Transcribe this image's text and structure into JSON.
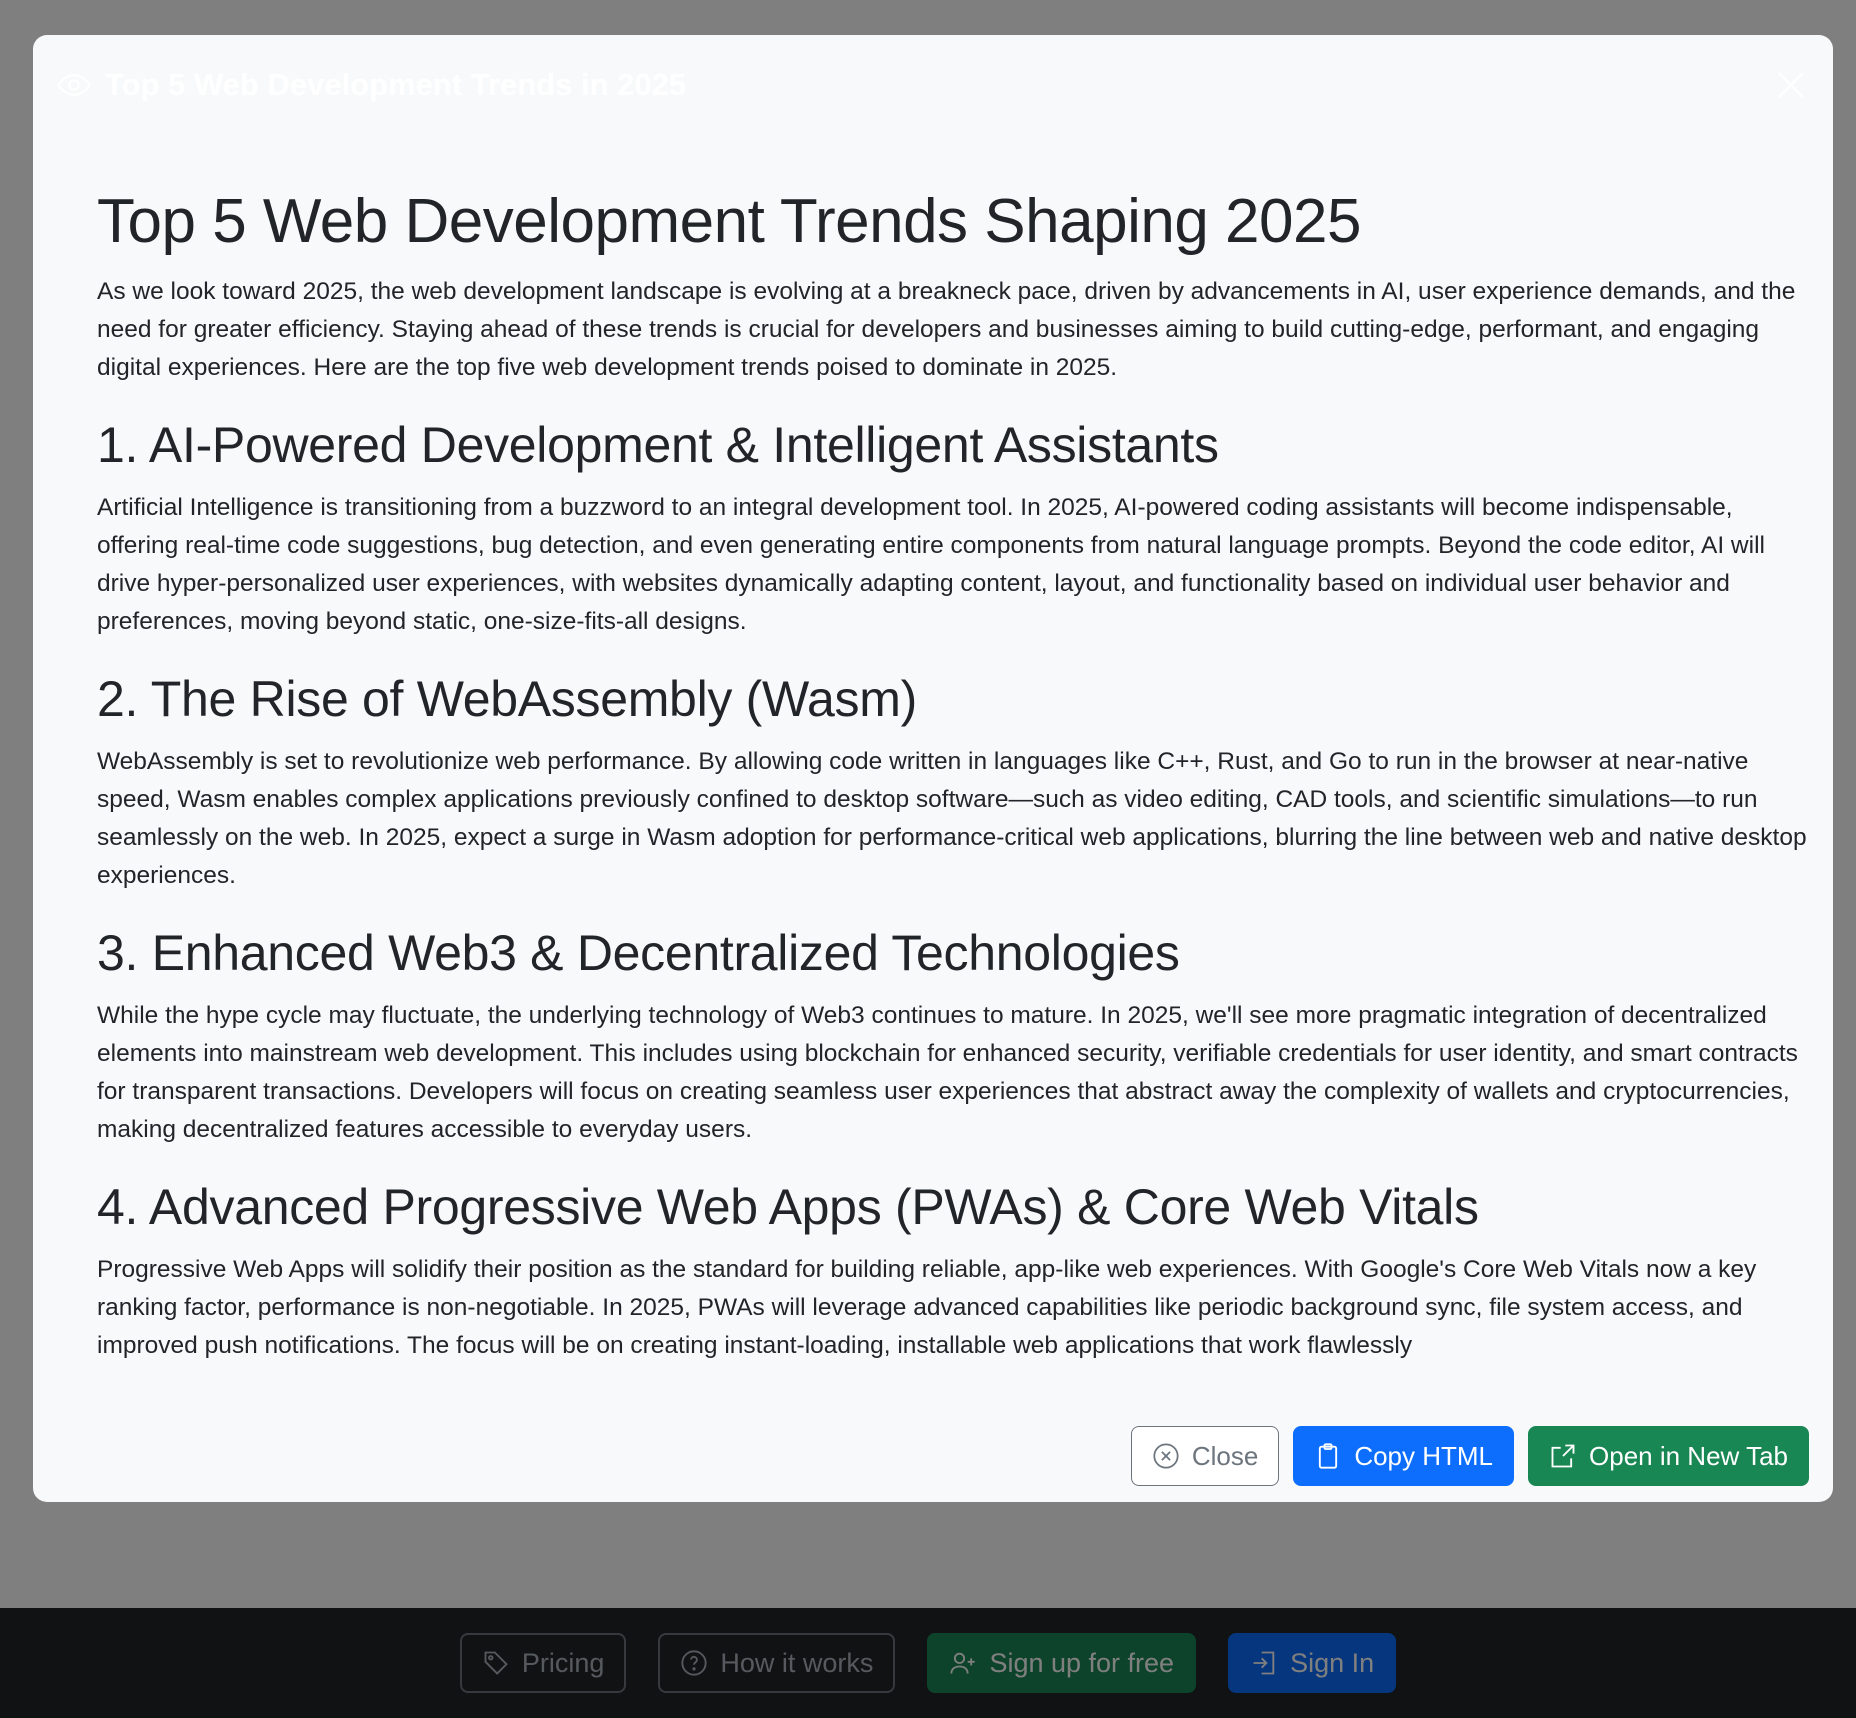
{
  "bottom_nav": {
    "pricing_label": "Pricing",
    "how_it_works_label": "How it works",
    "signup_label": "Sign up for free",
    "signin_label": "Sign In"
  },
  "modal": {
    "title": "Top 5 Web Development Trends in 2025",
    "article": {
      "heading": "Top 5 Web Development Trends Shaping 2025",
      "intro": "As we look toward 2025, the web development landscape is evolving at a breakneck pace, driven by advancements in AI, user experience demands, and the need for greater efficiency. Staying ahead of these trends is crucial for developers and businesses aiming to build cutting-edge, performant, and engaging digital experiences. Here are the top five web development trends poised to dominate in 2025.",
      "sections": [
        {
          "title": "1. AI-Powered Development & Intelligent Assistants",
          "body": "Artificial Intelligence is transitioning from a buzzword to an integral development tool. In 2025, AI-powered coding assistants will become indispensable, offering real-time code suggestions, bug detection, and even generating entire components from natural language prompts. Beyond the code editor, AI will drive hyper-personalized user experiences, with websites dynamically adapting content, layout, and functionality based on individual user behavior and preferences, moving beyond static, one-size-fits-all designs."
        },
        {
          "title": "2. The Rise of WebAssembly (Wasm)",
          "body": "WebAssembly is set to revolutionize web performance. By allowing code written in languages like C++, Rust, and Go to run in the browser at near-native speed, Wasm enables complex applications previously confined to desktop software—such as video editing, CAD tools, and scientific simulations—to run seamlessly on the web. In 2025, expect a surge in Wasm adoption for performance-critical web applications, blurring the line between web and native desktop experiences."
        },
        {
          "title": "3. Enhanced Web3 & Decentralized Technologies",
          "body": "While the hype cycle may fluctuate, the underlying technology of Web3 continues to mature. In 2025, we'll see more pragmatic integration of decentralized elements into mainstream web development. This includes using blockchain for enhanced security, verifiable credentials for user identity, and smart contracts for transparent transactions. Developers will focus on creating seamless user experiences that abstract away the complexity of wallets and cryptocurrencies, making decentralized features accessible to everyday users."
        },
        {
          "title": "4. Advanced Progressive Web Apps (PWAs) & Core Web Vitals",
          "body": "Progressive Web Apps will solidify their position as the standard for building reliable, app-like web experiences. With Google's Core Web Vitals now a key ranking factor, performance is non-negotiable. In 2025, PWAs will leverage advanced capabilities like periodic background sync, file system access, and improved push notifications. The focus will be on creating instant-loading, installable web applications that work flawlessly"
        }
      ]
    },
    "footer": {
      "close_label": "Close",
      "copy_label": "Copy HTML",
      "open_label": "Open in New Tab"
    }
  }
}
